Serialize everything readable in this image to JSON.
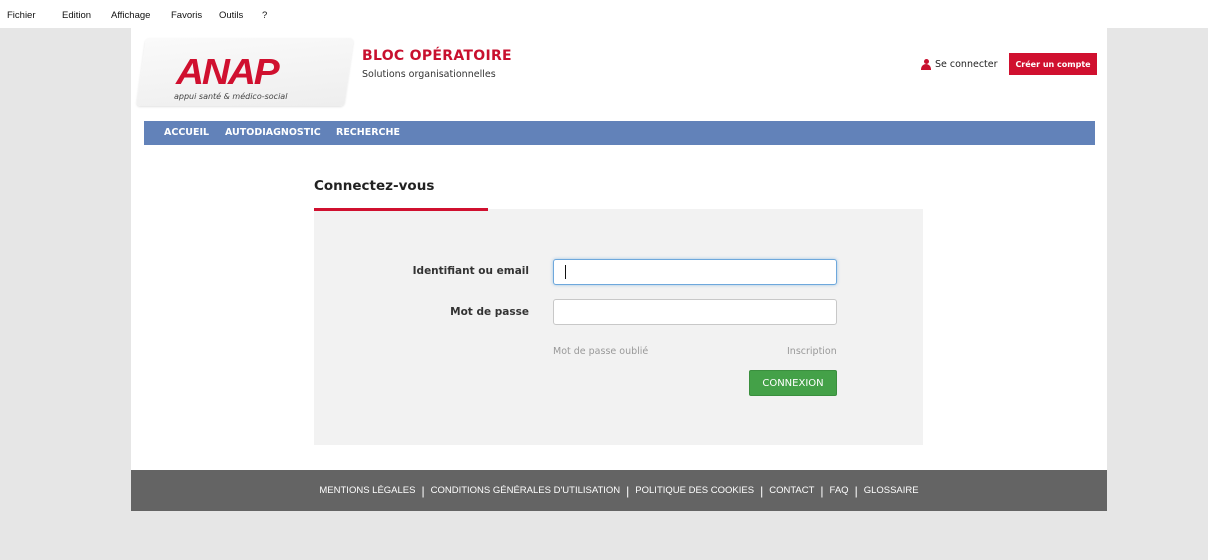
{
  "menubar": {
    "items": [
      "Fichier",
      "Edition",
      "Affichage",
      "Favoris",
      "Outils",
      "?"
    ]
  },
  "header": {
    "logo_text": "ANAP",
    "logo_tagline": "appui santé & médico-social",
    "title": "BLOC OPÉRATOIRE",
    "subtitle": "Solutions organisationnelles",
    "login_link": "Se connecter",
    "create_account": "Créer un compte"
  },
  "nav": {
    "items": [
      "ACCUEIL",
      "AUTODIAGNOSTIC",
      "RECHERCHE"
    ]
  },
  "login": {
    "title": "Connectez-vous",
    "username_label": "Identifiant ou email",
    "username_value": "",
    "password_label": "Mot de passe",
    "password_value": "",
    "forgot_password": "Mot de passe oublié",
    "register": "Inscription",
    "submit": "CONNEXION"
  },
  "footer": {
    "links": [
      "MENTIONS LÉGALES",
      "CONDITIONS GÉNÉRALES D'UTILISATION",
      "POLITIQUE DES COOKIES",
      "CONTACT",
      "FAQ",
      "GLOSSAIRE"
    ]
  },
  "colors": {
    "brand_red": "#d0102f",
    "nav_blue": "#6282b9",
    "button_green": "#44a148",
    "footer_gray": "#646464"
  },
  "icons": {
    "login": "user-icon"
  }
}
